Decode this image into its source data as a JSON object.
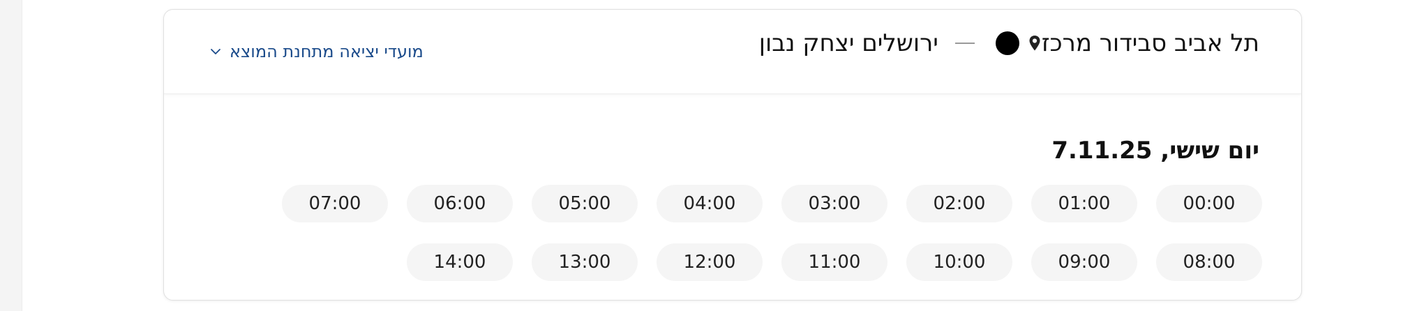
{
  "route": {
    "origin": "ירושלים יצחק נבון",
    "destination": "תל אביב סבידור מרכז"
  },
  "departures_link": {
    "label": "מועדי יציאה מתחנת המוצא",
    "icon": "chevron-down-icon"
  },
  "schedule": {
    "date_label": "יום שישי, 7.11.25",
    "times": [
      "00:00",
      "01:00",
      "02:00",
      "03:00",
      "04:00",
      "05:00",
      "06:00",
      "07:00",
      "08:00",
      "09:00",
      "10:00",
      "11:00",
      "12:00",
      "13:00",
      "14:00"
    ]
  },
  "colors": {
    "link": "#1a4a8a",
    "chip_background": "#f5f5f5",
    "text": "#111111"
  }
}
